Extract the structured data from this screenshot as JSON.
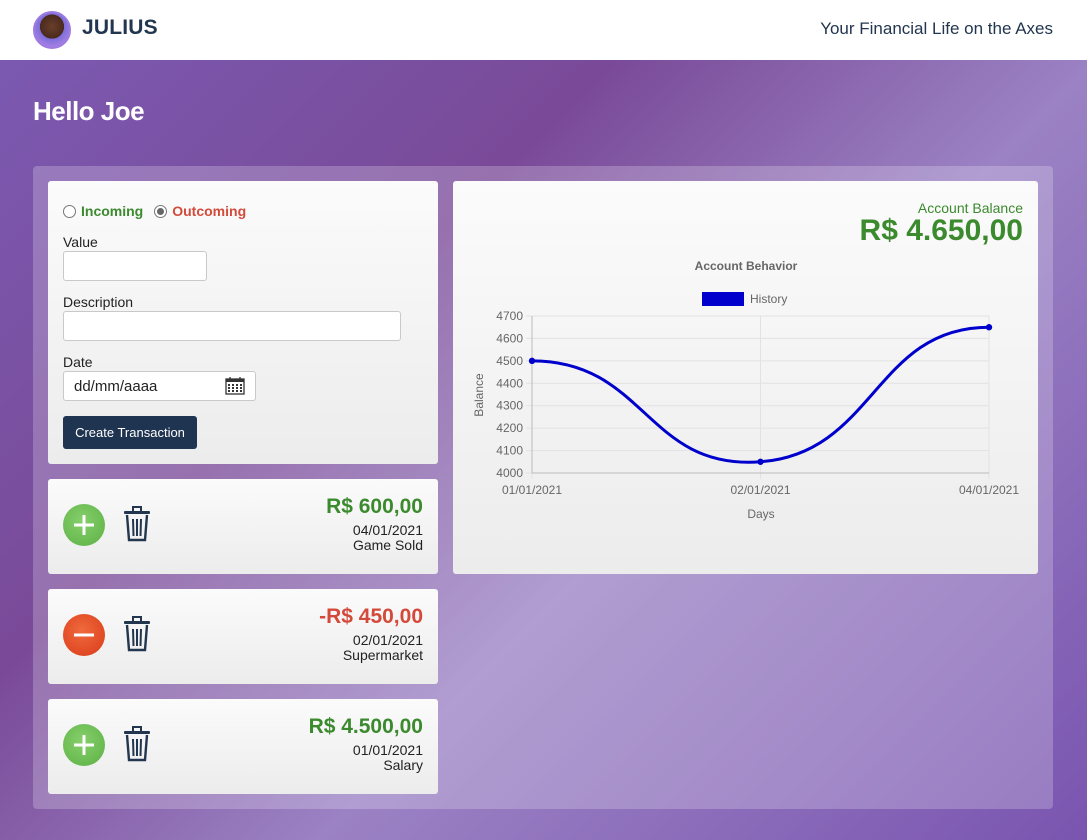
{
  "header": {
    "brand": "JULIUS",
    "tagline": "Your Financial Life on the Axes"
  },
  "greeting": "Hello Joe",
  "form": {
    "radio_incoming": "Incoming",
    "radio_outcoming": "Outcoming",
    "selected": "Outcoming",
    "value_label": "Value",
    "value_input": "",
    "description_label": "Description",
    "description_input": "",
    "date_label": "Date",
    "date_placeholder": "dd/mm/aaaa",
    "submit_label": "Create Transaction"
  },
  "transactions": [
    {
      "amount": "R$ 600,00",
      "date": "04/01/2021",
      "description": "Game Sold",
      "type": "incoming"
    },
    {
      "amount": "-R$ 450,00",
      "date": "02/01/2021",
      "description": "Supermarket",
      "type": "outcoming"
    },
    {
      "amount": "R$ 4.500,00",
      "date": "01/01/2021",
      "description": "Salary",
      "type": "incoming"
    }
  ],
  "balance": {
    "label": "Account Balance",
    "value": "R$ 4.650,00"
  },
  "colors": {
    "incoming": "#3c8a2e",
    "outcoming": "#d44a3a",
    "navy": "#1f3450",
    "series": "#0000cc"
  },
  "chart_data": {
    "type": "line",
    "title": "Account Behavior",
    "xlabel": "Days",
    "ylabel": "Balance",
    "categories": [
      "01/01/2021",
      "02/01/2021",
      "04/01/2021"
    ],
    "series": [
      {
        "name": "History",
        "values": [
          4500,
          4050,
          4650
        ]
      }
    ],
    "ylim": [
      4000,
      4700
    ],
    "yticks": [
      4000,
      4100,
      4200,
      4300,
      4400,
      4500,
      4600,
      4700
    ],
    "legend": "top-center",
    "grid": true
  }
}
